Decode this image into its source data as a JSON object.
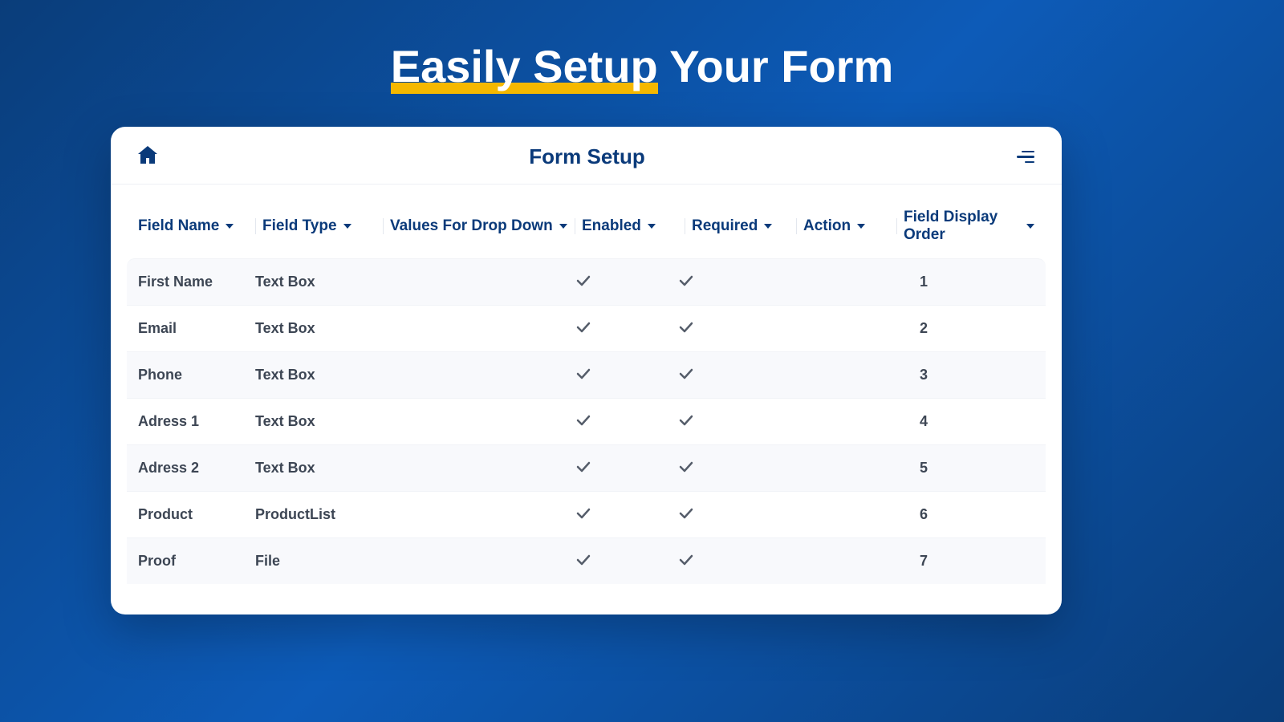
{
  "page": {
    "title_highlight": "Easily Setup",
    "title_rest": " Your Form"
  },
  "card": {
    "title": "Form Setup"
  },
  "columns": {
    "field_name": "Field Name",
    "field_type": "Field Type",
    "values": "Values For Drop Down",
    "enabled": "Enabled",
    "required": "Required",
    "action": "Action",
    "order": "Field Display Order"
  },
  "rows": [
    {
      "name": "First Name",
      "type": "Text Box",
      "values": "",
      "enabled": true,
      "required": true,
      "action": "",
      "order": "1"
    },
    {
      "name": "Email",
      "type": "Text Box",
      "values": "",
      "enabled": true,
      "required": true,
      "action": "",
      "order": "2"
    },
    {
      "name": "Phone",
      "type": "Text Box",
      "values": "",
      "enabled": true,
      "required": true,
      "action": "",
      "order": "3"
    },
    {
      "name": "Adress 1",
      "type": "Text Box",
      "values": "",
      "enabled": true,
      "required": true,
      "action": "",
      "order": "4"
    },
    {
      "name": "Adress 2",
      "type": "Text Box",
      "values": "",
      "enabled": true,
      "required": true,
      "action": "",
      "order": "5"
    },
    {
      "name": "Product",
      "type": "ProductList",
      "values": "",
      "enabled": true,
      "required": true,
      "action": "",
      "order": "6"
    },
    {
      "name": "Proof",
      "type": "File",
      "values": "",
      "enabled": true,
      "required": true,
      "action": "",
      "order": "7"
    }
  ]
}
